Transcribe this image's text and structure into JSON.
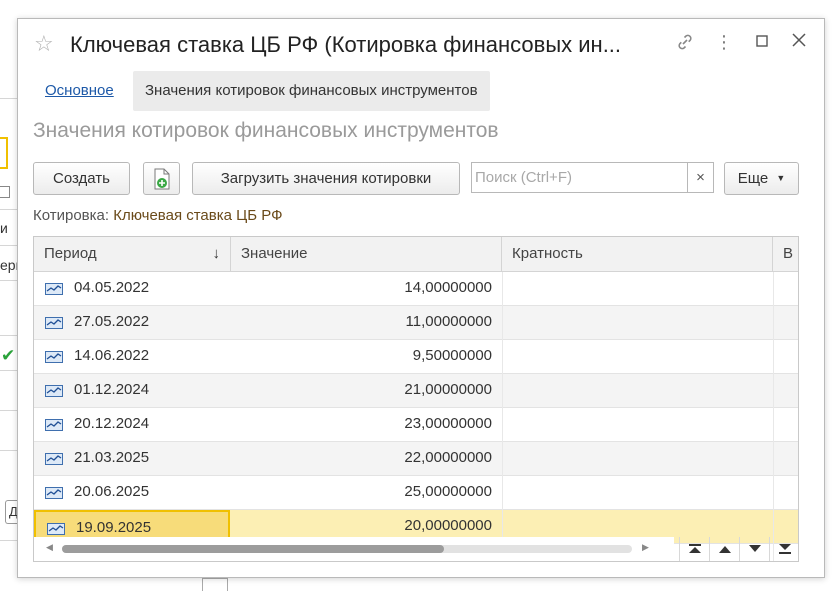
{
  "background": {
    "fragments": [
      "и",
      "ери",
      "Д"
    ]
  },
  "window": {
    "title": "Ключевая ставка ЦБ РФ (Котировка финансовых ин...",
    "icons": [
      "star-icon",
      "link-icon",
      "more-icon",
      "maximize-icon",
      "close-icon"
    ]
  },
  "tabs": {
    "main_link": "Основное",
    "active": "Значения котировок финансовых инструментов"
  },
  "form_title": "Значения котировок финансовых инструментов",
  "toolbar": {
    "create": "Создать",
    "load": "Загрузить значения котировки",
    "more": "Еще",
    "search_placeholder": "Поиск (Ctrl+F)",
    "clear": "×"
  },
  "quote": {
    "label": "Котировка:",
    "value": "Ключевая ставка ЦБ РФ"
  },
  "table": {
    "columns": [
      "Период",
      "Значение",
      "Кратность",
      "В"
    ],
    "sort_indicator": "↓",
    "rows": [
      {
        "period": "04.05.2022",
        "value": "14,00000000"
      },
      {
        "period": "27.05.2022",
        "value": "11,00000000"
      },
      {
        "period": "14.06.2022",
        "value": "9,50000000"
      },
      {
        "period": "01.12.2024",
        "value": "21,00000000"
      },
      {
        "period": "20.12.2024",
        "value": "23,00000000"
      },
      {
        "period": "21.03.2025",
        "value": "22,00000000"
      },
      {
        "period": "20.06.2025",
        "value": "25,00000000"
      },
      {
        "period": "19.09.2025",
        "value": "20,00000000"
      }
    ],
    "selected_row": 7,
    "horizontal_scroll_fraction": 0.67
  },
  "colors": {
    "accent_link": "#1d59a8",
    "selection": "#fcefb4",
    "selection_border": "#f0c000"
  }
}
